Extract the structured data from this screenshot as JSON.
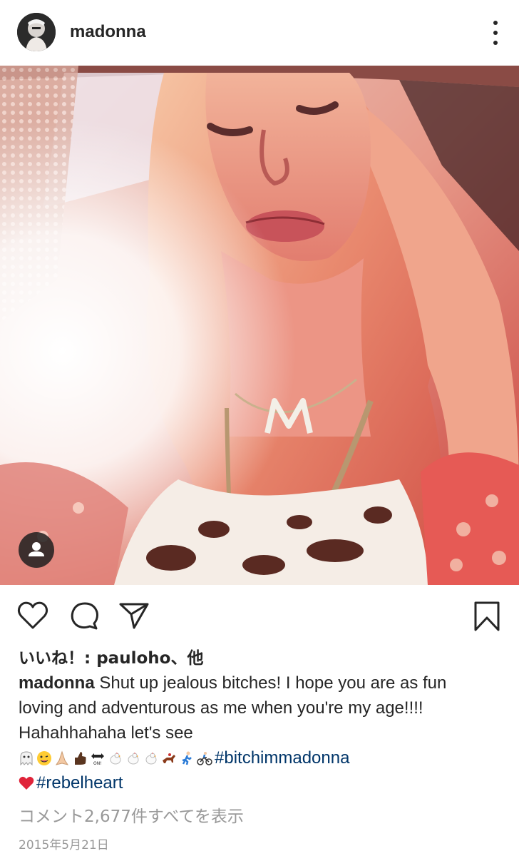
{
  "header": {
    "username": "madonna",
    "avatar_icon": "profile-avatar",
    "more_icon": "more-vertical-icon"
  },
  "post": {
    "image_description_icon": "photo",
    "tag_icon": "user-tag-icon"
  },
  "actions": {
    "like_icon": "heart-icon",
    "comment_icon": "comment-icon",
    "share_icon": "send-icon",
    "save_icon": "bookmark-icon"
  },
  "likes": {
    "prefix": "いいね！: ",
    "user": "pauloho",
    "suffix": "、他"
  },
  "caption": {
    "username": "madonna",
    "text_line1": " Shut up jealous bitches! I hope you are as fun",
    "text_line2": "loving and adventurous as me when you're my age!!!!",
    "text_line3": "Hahahhahaha let's see",
    "hashtag1": "#bitchimmadonna",
    "hashtag2": "#rebelheart"
  },
  "comments_link": "コメント2,677件すべてを表示",
  "timestamp": "2015年5月21日",
  "colors": {
    "text": "#262626",
    "hashtag": "#003569",
    "muted": "#999999"
  }
}
